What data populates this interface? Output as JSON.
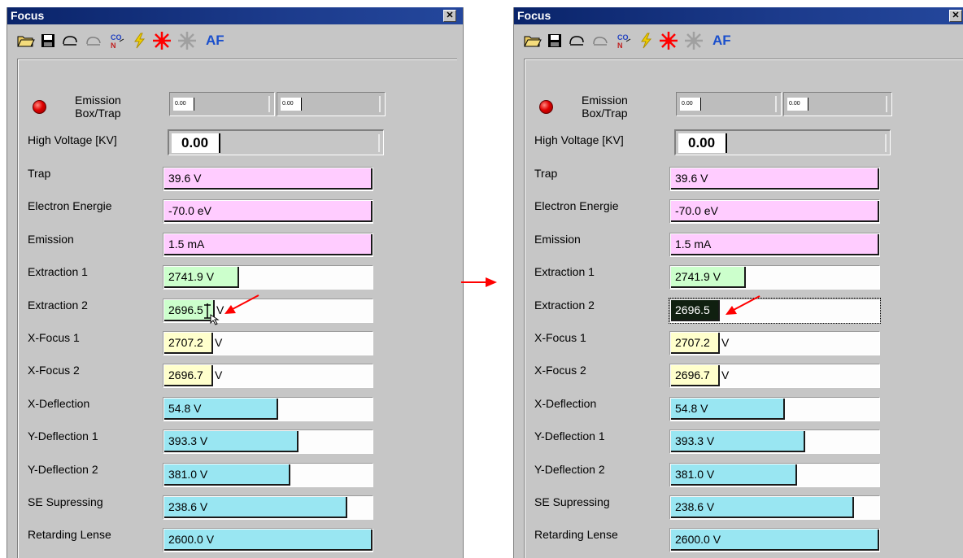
{
  "panels": [
    {
      "title": "Focus",
      "toolbar": {
        "af_label": "AF"
      },
      "emission": {
        "label": "Emission\nBox/Trap",
        "box_value": "0.00",
        "trap_value": "0.00"
      },
      "high_voltage": {
        "label": "High Voltage [KV]",
        "value": "0.00"
      },
      "rows": [
        {
          "label": "Trap",
          "value": "39.6 V"
        },
        {
          "label": "Electron Energie",
          "value": "-70.0 eV"
        },
        {
          "label": "Emission",
          "value": "1.5 mA"
        },
        {
          "label": "Extraction 1",
          "value": "2741.9 V"
        },
        {
          "label": "Extraction 2",
          "value": "2696.5",
          "tail": "V"
        },
        {
          "label": "X-Focus 1",
          "value": "2707.2",
          "tail": "V"
        },
        {
          "label": "X-Focus 2",
          "value": "2696.7",
          "tail": "V"
        },
        {
          "label": "X-Deflection",
          "value": "54.8 V"
        },
        {
          "label": "Y-Deflection 1",
          "value": "393.3 V"
        },
        {
          "label": "Y-Deflection 2",
          "value": "381.0 V"
        },
        {
          "label": "SE Supressing",
          "value": "238.6 V"
        },
        {
          "label": "Retarding Lense",
          "value": "2600.0 V"
        }
      ]
    },
    {
      "title": "Focus",
      "toolbar": {
        "af_label": "AF"
      },
      "emission": {
        "label": "Emission\nBox/Trap",
        "box_value": "0.00",
        "trap_value": "0.00"
      },
      "high_voltage": {
        "label": "High Voltage [KV]",
        "value": "0.00"
      },
      "rows": [
        {
          "label": "Trap",
          "value": "39.6 V"
        },
        {
          "label": "Electron Energie",
          "value": "-70.0 eV"
        },
        {
          "label": "Emission",
          "value": "1.5 mA"
        },
        {
          "label": "Extraction 1",
          "value": "2741.9 V"
        },
        {
          "label": "Extraction 2",
          "value": "2696.5"
        },
        {
          "label": "X-Focus 1",
          "value": "2707.2",
          "tail": "V"
        },
        {
          "label": "X-Focus 2",
          "value": "2696.7",
          "tail": "V"
        },
        {
          "label": "X-Deflection",
          "value": "54.8 V"
        },
        {
          "label": "Y-Deflection 1",
          "value": "393.3 V"
        },
        {
          "label": "Y-Deflection 2",
          "value": "381.0 V"
        },
        {
          "label": "SE Supressing",
          "value": "238.6 V"
        },
        {
          "label": "Retarding Lense",
          "value": "2600.0 V"
        }
      ]
    }
  ],
  "colors": {
    "title_bar": "#0a246a",
    "pink": "#ffccff",
    "green": "#ccffcc",
    "yellow": "#ffffcc",
    "cyan": "#99e6f2",
    "annotation_arrow": "#ff0000"
  },
  "icons": [
    "open-folder-icon",
    "save-disk-icon",
    "undo-icon",
    "redo-icon",
    "gas-co-n2-icon",
    "lightning-icon",
    "red-star-icon",
    "gray-star-icon"
  ]
}
